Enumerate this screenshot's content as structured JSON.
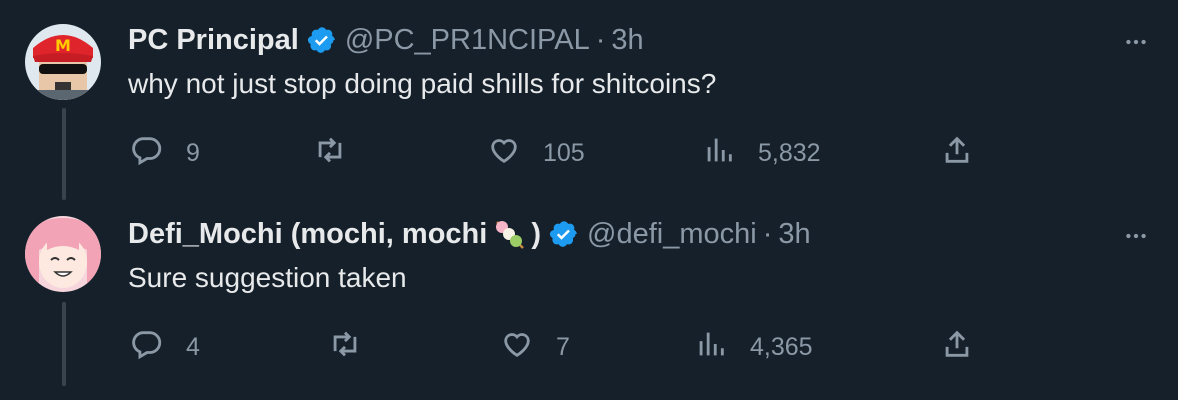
{
  "tweets": [
    {
      "name": "PC Principal",
      "handle": "@PC_PR1NCIPAL",
      "separator": "·",
      "time": "3h",
      "text": "why not just stop doing paid shills for shitcoins?",
      "actions": {
        "reply": "9",
        "retweet": "",
        "like": "105",
        "views": "5,832"
      }
    },
    {
      "name": "Defi_Mochi (mochi, mochi",
      "name_suffix": ")",
      "handle": "@defi_mochi",
      "separator": "·",
      "time": "3h",
      "text": "Sure suggestion taken",
      "actions": {
        "reply": "4",
        "retweet": "",
        "like": "7",
        "views": "4,365"
      }
    }
  ],
  "colors": {
    "background": "#15202b",
    "text_primary": "#e7e9ea",
    "text_secondary": "#8b98a5",
    "verified_blue": "#1d9bf0",
    "thread_line": "#38444d"
  },
  "icons": {
    "reply": "reply-icon",
    "retweet": "retweet-icon",
    "like": "heart-icon",
    "views": "views-icon",
    "share": "share-icon",
    "more": "more-icon",
    "verified": "verified-badge-icon",
    "dango_emoji": "dango-emoji-icon"
  }
}
